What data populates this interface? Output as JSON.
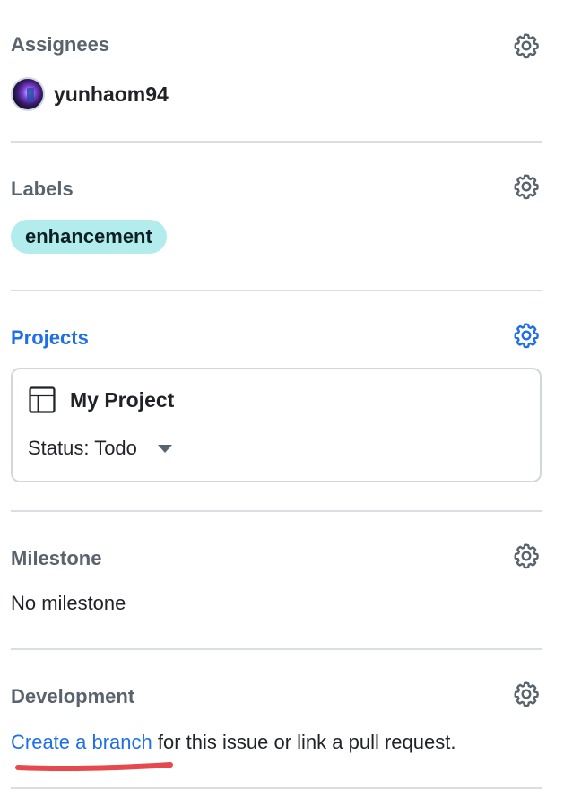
{
  "assignees": {
    "title": "Assignees",
    "user": "yunhaom94"
  },
  "labels": {
    "title": "Labels",
    "items": [
      "enhancement"
    ],
    "label_color": "#b2ecec"
  },
  "projects": {
    "title": "Projects",
    "project_name": "My Project",
    "status": "Status: Todo",
    "accent": "#1f6feb"
  },
  "milestone": {
    "title": "Milestone",
    "value": "No milestone"
  },
  "development": {
    "title": "Development",
    "link_text": "Create a branch",
    "rest_text": " for this issue or link a pull request.",
    "annotation_color": "#e5484d"
  },
  "icons": {
    "gear": "gear-icon",
    "table": "table-icon",
    "caret": "triangle-down-icon"
  }
}
